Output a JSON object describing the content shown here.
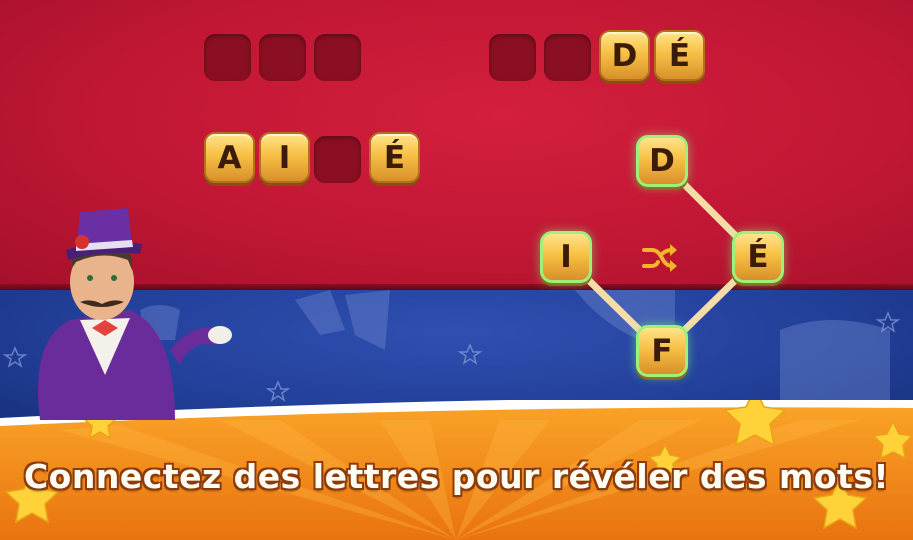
{
  "board": {
    "rows": [
      {
        "cells": [
          "",
          "",
          ""
        ]
      },
      {
        "cells": [
          "",
          "",
          "D",
          "É"
        ]
      },
      {
        "cells": [
          "A",
          "I",
          "",
          "É"
        ]
      }
    ]
  },
  "wheel": {
    "letters": [
      "D",
      "I",
      "É",
      "F"
    ],
    "shuffle_icon": "shuffle-icon"
  },
  "caption": "Connectez des lettres pour révéler des mots!",
  "colors": {
    "top_background": "#c01734",
    "middle_background": "#223f98",
    "bottom_background": "#f08a16",
    "tile_fill": "#f7c045",
    "tile_empty": "#8a0f22",
    "selection_glow": "#9ff07b"
  }
}
